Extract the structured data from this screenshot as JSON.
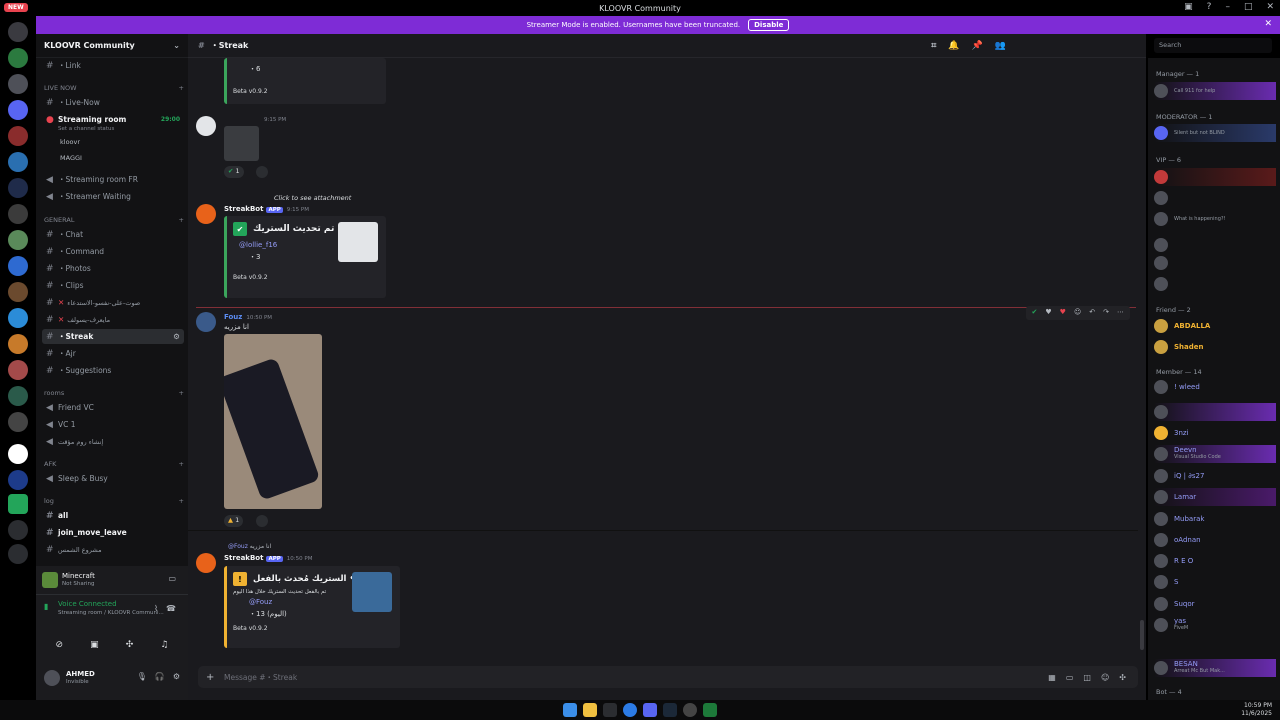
{
  "window": {
    "title": "KLOOVR Community",
    "new_badge": "NEW"
  },
  "banner": {
    "text": "Streamer Mode is enabled. Usernames have been truncated.",
    "disable_label": "Disable"
  },
  "server": {
    "name": "KLOOVR Community"
  },
  "channels": {
    "link": "・Link",
    "cat_live": "LIVE NOW",
    "live_now": "・Live-Now",
    "streaming_room": "Streaming room",
    "streaming_status": "Set a channel status",
    "streaming_time": "29:00",
    "voice_user1": "kloovr",
    "voice_user2": "MAGGI",
    "streaming_fr": "・Streaming room FR",
    "streamer_waiting": "・Streamer Waiting",
    "cat_general": "GENERAL",
    "chat": "・Chat",
    "command": "・Command",
    "photos": "・Photos",
    "clips": "・Clips",
    "arabic1": "صوت-على-نفسو-الاستدعاء",
    "arabic2": "مايعرف-يسولف",
    "streak": "・Streak",
    "ajr": "・Ajr",
    "suggestions": "・Suggestions",
    "cat_rooms": "rooms",
    "friend_vc": "Friend VC",
    "vc1": "VC 1",
    "arabic3": "إنشاء روم مؤقت",
    "cat_afk": "AFK",
    "sleep_busy": "Sleep & Busy",
    "cat_log": "log",
    "all": "all",
    "join_move_leave": "join_move_leave",
    "arabic4": "مشروع الشمس"
  },
  "activity": {
    "game": "Minecraft",
    "status": "Not Sharing"
  },
  "voice": {
    "status": "Voice Connected",
    "location": "Streaming room / KLOOVR Communi..."
  },
  "user": {
    "name": "AHMED",
    "status": "Invisible"
  },
  "chat": {
    "channel_name": "・Streak",
    "search_placeholder": "Search",
    "embed_top": {
      "line1": "・6",
      "version": "Beta v0.9.2"
    },
    "msg_time1": "9:15 PM",
    "react1": "1",
    "click_attachment": "Click to see attachment",
    "streakbot_name": "StreakBot",
    "app_badge": "APP",
    "streakbot_time1": "9:15 PM",
    "embed2_title": "تم تحديث الستريك •",
    "embed2_mention": "@lollie_f16",
    "embed2_count": "・3",
    "embed2_version": "Beta v0.9.2",
    "fouz_name": "Fouz",
    "fouz_time": "10:50 PM",
    "fouz_text": "انا مزريه",
    "react2": "1",
    "reply_ref": "@Fouz",
    "reply_text": "انا مزريه",
    "streakbot_time2": "10:50 PM",
    "embed3_title": "الستريك مُحدث بالفعل •",
    "embed3_sub": "تم بالفعل تحديث الستريك خلال هذا اليوم",
    "embed3_mention": "@Fouz",
    "embed3_count": "・13 (اليوم)",
    "embed3_version": "Beta v0.9.2",
    "composer_placeholder": "Message #・Streak"
  },
  "members": {
    "cat_manager": "Manager — 1",
    "m1_sub": "Call 911 for help",
    "cat_moderator": "MODERATOR — 1",
    "m2_sub": "Silent but not BLIND",
    "cat_vip": "VIP — 6",
    "vip_sub": "What is happening?!",
    "cat_friend": "Friend — 2",
    "f1": "ABDALLA",
    "f2": "Shaden",
    "cat_member": "Member — 14",
    "m_wleed": "! wleed",
    "m_3nzi": "3nzi",
    "m_deevn": "Deevn",
    "m_deevn_sub": "Visual Studio Code",
    "m_iq": "iQ | ∂s27",
    "m_lamar": "Lamar",
    "m_mubarak": "Mubarak",
    "m_oadnan": "oAdnan",
    "m_reo": "R E O",
    "m_s": "S",
    "m_suqor": "Suqor",
    "m_yas": "yas",
    "m_yas_sub": "FiveM",
    "m_besan": "BESAN",
    "m_besan_sub": "Arreat Mc But Mak...",
    "cat_bot": "Bot — 4"
  },
  "taskbar": {
    "time": "10:59 PM",
    "date": "11/6/2025"
  },
  "colors": {
    "accent": "#7e2cd6",
    "embed_green": "#3ba55c",
    "embed_yellow": "#f0b232",
    "online": "#23a55a"
  }
}
